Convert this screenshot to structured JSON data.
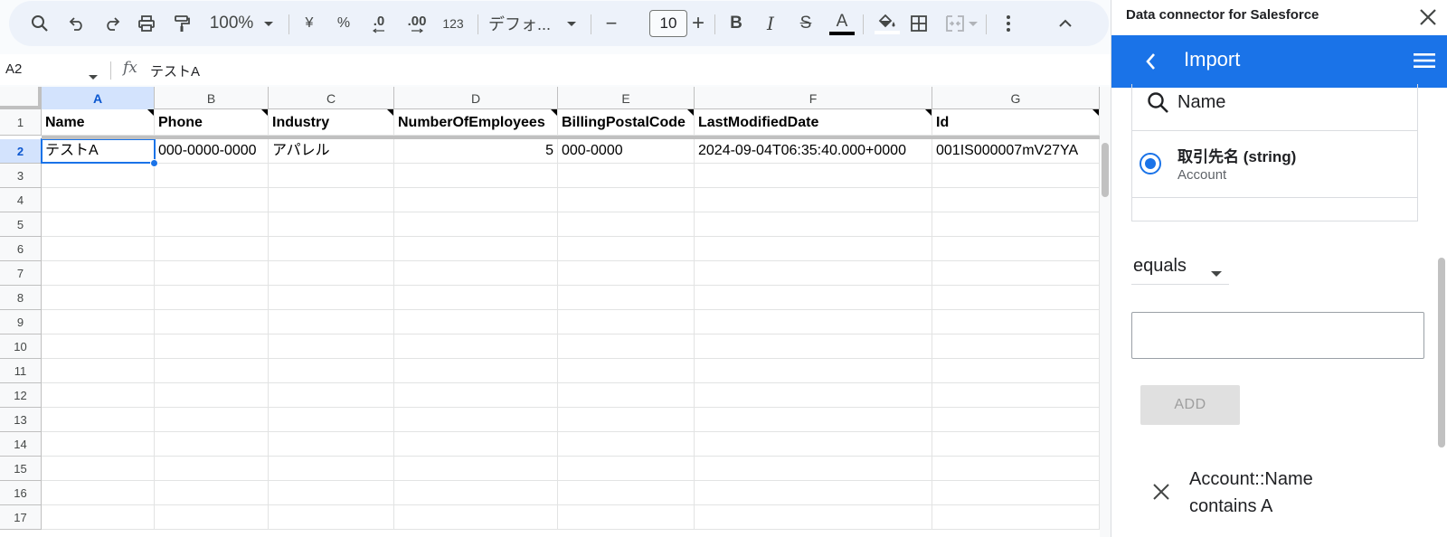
{
  "toolbar": {
    "zoom": "100%",
    "currency_symbol": "¥",
    "percent_symbol": "%",
    "decrease_decimal": ".0",
    "increase_decimal": ".00",
    "number_format": "123",
    "font_name": "デフォ...",
    "font_size": "10",
    "minus": "−",
    "plus": "+",
    "bold": "B",
    "italic": "I",
    "strike": "S",
    "text_color_letter": "A"
  },
  "formula_bar": {
    "cell_ref": "A2",
    "fx": "fx",
    "value": "テストA"
  },
  "grid": {
    "columns": [
      "A",
      "B",
      "C",
      "D",
      "E",
      "F",
      "G"
    ],
    "rows": [
      "1",
      "2",
      "3",
      "4",
      "5",
      "6",
      "7",
      "8",
      "9",
      "10",
      "11",
      "12",
      "13",
      "14",
      "15",
      "16",
      "17"
    ],
    "header_cells": [
      "Name",
      "Phone",
      "Industry",
      "NumberOfEmployees",
      "BillingPostalCode",
      "LastModifiedDate",
      "Id"
    ],
    "data_row": [
      "テストA",
      "000-0000-0000",
      "アパレル",
      "5",
      "000-0000",
      "2024-09-04T06:35:40.000+0000",
      "001IS000007mV27YA"
    ]
  },
  "panel": {
    "title": "Data connector for Salesforce",
    "app_title": "Import",
    "search_text": "Name",
    "option_main": "取引先名 (string)",
    "option_sub": "Account",
    "operator": "equals",
    "value_input": "",
    "add_label": "ADD",
    "filter_line1": "Account::Name",
    "filter_line2": "contains A"
  }
}
